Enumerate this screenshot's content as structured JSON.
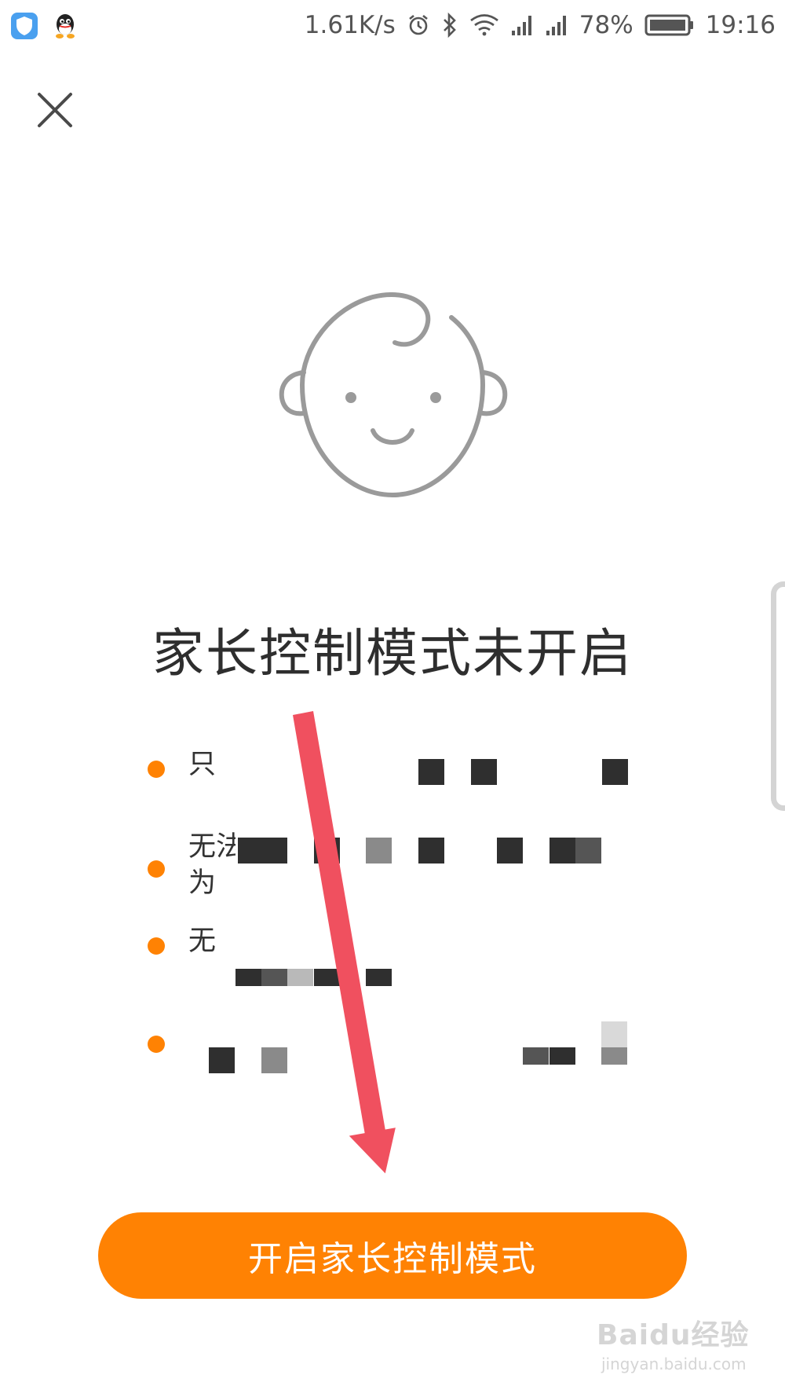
{
  "status_bar": {
    "network_speed": "1.61K/s",
    "battery_percent": "78%",
    "time": "19:16",
    "icons": [
      "shield-app-icon",
      "qq-app-icon",
      "alarm-icon",
      "bluetooth-icon",
      "wifi-icon",
      "signal-icon",
      "signal-icon",
      "battery-icon"
    ]
  },
  "header": {
    "close_icon": "close-icon"
  },
  "illustration": {
    "icon": "baby-face-icon"
  },
  "main": {
    "title": "家长控制模式未开启",
    "features": [
      {
        "text": "只"
      },
      {
        "text": "无法\n为"
      },
      {
        "text": "无"
      },
      {
        "text": "\n"
      }
    ]
  },
  "actions": {
    "enable_label": "开启家长控制模式"
  },
  "watermark": {
    "brand": "Baidu经验",
    "url": "jingyan.baidu.com"
  },
  "colors": {
    "accent": "#ff8203",
    "annotation": "#f0505f",
    "icon_gray": "#9a9a9a"
  }
}
